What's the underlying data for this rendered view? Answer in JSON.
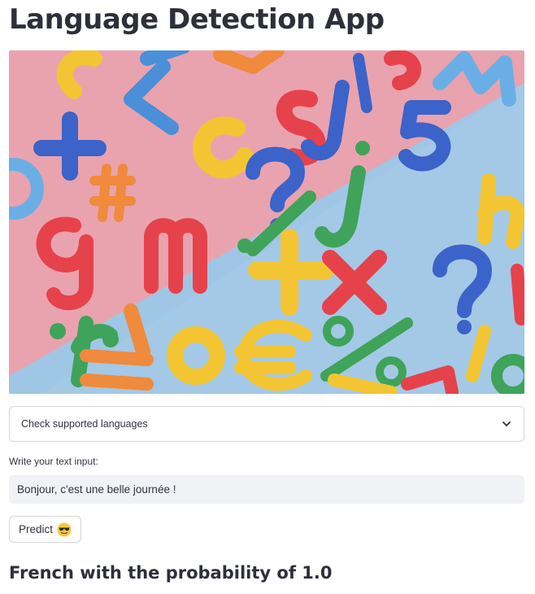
{
  "app": {
    "title": "Language Detection App"
  },
  "expander": {
    "label": "Check supported languages",
    "icon": "chevron-down-icon"
  },
  "input": {
    "label": "Write your text input:",
    "value": "Bonjour, c'est une belle journée !"
  },
  "predict_button": {
    "label": "Predict",
    "icon": "smiling-face-with-sunglasses-icon"
  },
  "result": {
    "text": "French with the probability of 1.0"
  },
  "colors": {
    "title": "#2d2f3a",
    "text": "#31333f",
    "input_bg": "#f0f2f6",
    "border": "#d6d6d9",
    "hero_pink": "#e8a2ad",
    "hero_blue": "#9fc6e4"
  }
}
